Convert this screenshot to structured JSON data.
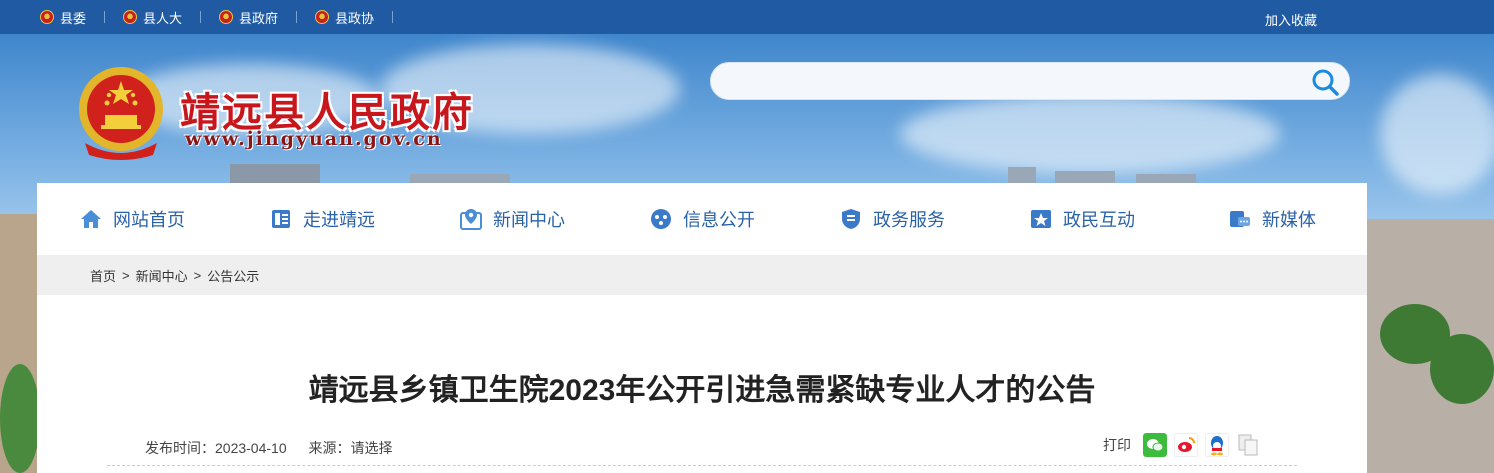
{
  "topbar": {
    "links": [
      {
        "label": "县委"
      },
      {
        "label": "县人大"
      },
      {
        "label": "县政府"
      },
      {
        "label": "县政协"
      }
    ],
    "favorite": "加入收藏"
  },
  "header": {
    "site_title": "靖远县人民政府",
    "site_url": "www.jingyuan.gov.cn",
    "search_placeholder": ""
  },
  "nav": {
    "items": [
      {
        "label": "网站首页",
        "icon": "home-icon"
      },
      {
        "label": "走进靖远",
        "icon": "book-icon"
      },
      {
        "label": "新闻中心",
        "icon": "map-pin-icon"
      },
      {
        "label": "信息公开",
        "icon": "info-dots-icon"
      },
      {
        "label": "政务服务",
        "icon": "service-shield-icon"
      },
      {
        "label": "政民互动",
        "icon": "star-icon"
      },
      {
        "label": "新媒体",
        "icon": "media-chat-icon"
      }
    ]
  },
  "breadcrumb": {
    "items": [
      "首页",
      "新闻中心",
      "公告公示"
    ],
    "separator": ">"
  },
  "article": {
    "title": "靖远县乡镇卫生院2023年公开引进急需紧缺专业人才的公告",
    "publish_time": "发布时间：2023-04-10",
    "source": "来源：请选择"
  },
  "share": {
    "print_label": "打印",
    "icons": [
      "wechat-icon",
      "weibo-icon",
      "qq-icon",
      "copy-icon"
    ]
  },
  "colors": {
    "topbar": "#1f5aa3",
    "nav_text": "#2a62a8",
    "title_red": "#c8161d"
  }
}
